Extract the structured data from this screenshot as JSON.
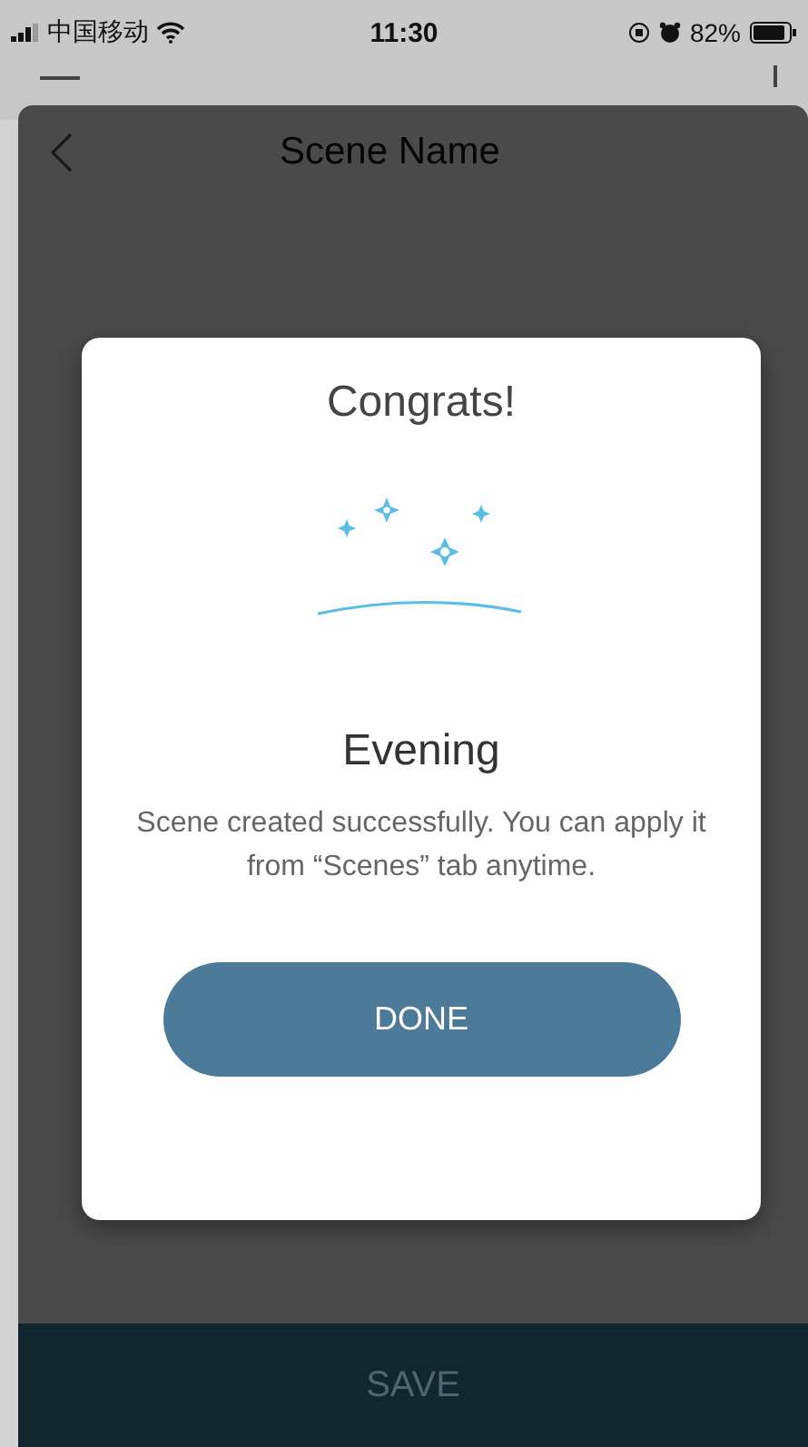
{
  "status_bar": {
    "carrier": "中国移动",
    "time": "11:30",
    "battery": "82%"
  },
  "sheet": {
    "title": "Scene Name",
    "save_button": "SAVE"
  },
  "dialog": {
    "title": "Congrats!",
    "scene_name": "Evening",
    "message": "Scene created successfully. You can apply it from “Scenes” tab anytime.",
    "button": "DONE"
  }
}
